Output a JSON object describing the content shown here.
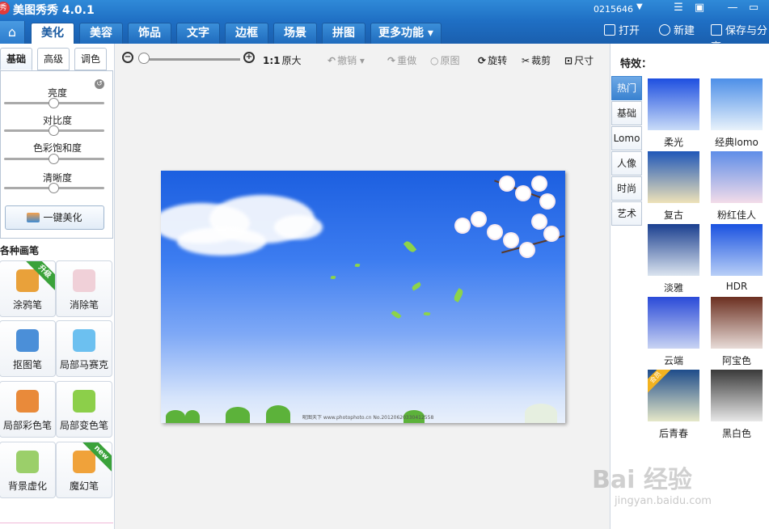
{
  "app": {
    "logo_text": "秀",
    "title": "美图秀秀 4.0.1",
    "user_id": "0215646",
    "window_controls": [
      "menu-icon",
      "minimize-icon",
      "maximize-icon",
      "close-icon"
    ]
  },
  "nav": {
    "home_icon": "home-icon",
    "tabs": [
      {
        "label": "美化",
        "active": true
      },
      {
        "label": "美容",
        "active": false
      },
      {
        "label": "饰品",
        "active": false
      },
      {
        "label": "文字",
        "active": false
      },
      {
        "label": "边框",
        "active": false
      },
      {
        "label": "场景",
        "active": false
      },
      {
        "label": "拼图",
        "active": false
      },
      {
        "label": "更多功能 ▾",
        "active": false
      }
    ],
    "right": [
      {
        "label": "打开",
        "icon": "folder-icon"
      },
      {
        "label": "新建",
        "icon": "plus-icon"
      },
      {
        "label": "保存与分享",
        "icon": "save-icon"
      }
    ]
  },
  "left": {
    "tabs": [
      {
        "label": "基础",
        "active": true
      },
      {
        "label": "高级",
        "active": false
      },
      {
        "label": "调色",
        "active": false
      }
    ],
    "sliders": [
      {
        "label": "亮度",
        "value": 0.5
      },
      {
        "label": "对比度",
        "value": 0.5
      },
      {
        "label": "色彩饱和度",
        "value": 0.5
      },
      {
        "label": "清晰度",
        "value": 0.5
      }
    ],
    "one_click": "一键美化",
    "brush_section": "各种画笔",
    "brushes": [
      {
        "label": "涂鸦笔",
        "icon": "graffiti-brush-icon",
        "badge": "升级",
        "color": "#e9a13a"
      },
      {
        "label": "消除笔",
        "icon": "eraser-icon",
        "badge": "",
        "color": "#f0d0d8"
      },
      {
        "label": "抠图笔",
        "icon": "cutout-pen-icon",
        "badge": "",
        "color": "#4b8fd8"
      },
      {
        "label": "局部马赛克",
        "icon": "mosaic-icon",
        "badge": "",
        "color": "#6cc0f0"
      },
      {
        "label": "局部彩色笔",
        "icon": "color-brush-icon",
        "badge": "",
        "color": "#e98a3a"
      },
      {
        "label": "局部变色笔",
        "icon": "recolor-bucket-icon",
        "badge": "",
        "color": "#8ccf4a"
      },
      {
        "label": "背景虚化",
        "icon": "blur-background-icon",
        "badge": "",
        "color": "#9bcf6a"
      },
      {
        "label": "魔幻笔",
        "icon": "magic-wand-icon",
        "badge": "new",
        "color": "#f0a23a"
      }
    ]
  },
  "toolbar": {
    "zoom": {
      "value": 0.0
    },
    "original_size_prefix": "1:1",
    "original_size": "原大",
    "undo": "撤销",
    "redo": "重做",
    "original": "原图",
    "rotate": "旋转",
    "crop": "裁剪",
    "resize": "尺寸"
  },
  "canvas": {
    "watermark": "昵图天下 www.photophoto.cn  No.20120620330412558"
  },
  "right": {
    "title": "特效：",
    "tabs": [
      {
        "label": "热门",
        "active": true
      },
      {
        "label": "基础",
        "active": false
      },
      {
        "label": "Lomo",
        "active": false
      },
      {
        "label": "人像",
        "active": false
      },
      {
        "label": "时尚",
        "active": false
      },
      {
        "label": "艺术",
        "active": false
      }
    ],
    "effects": [
      {
        "label": "柔光",
        "top": "#1e4fe0",
        "bottom": "#c9dcf8",
        "vip": false
      },
      {
        "label": "经典lomo",
        "top": "#4d8fe8",
        "bottom": "#e8f2fb",
        "vip": false
      },
      {
        "label": "复古",
        "top": "#1f57b8",
        "bottom": "#eee2b8",
        "vip": false
      },
      {
        "label": "粉红佳人",
        "top": "#5e8de8",
        "bottom": "#f3dce9",
        "vip": false
      },
      {
        "label": "淡雅",
        "top": "#1a3f8f",
        "bottom": "#dbe4ef",
        "vip": false
      },
      {
        "label": "HDR",
        "top": "#1a52e0",
        "bottom": "#b8cff7",
        "vip": false
      },
      {
        "label": "云端",
        "top": "#2a4ad8",
        "bottom": "#c9d4f3",
        "vip": false
      },
      {
        "label": "阿宝色",
        "top": "#6b2f20",
        "bottom": "#e8dcd8",
        "vip": false
      },
      {
        "label": "后青春",
        "top": "#1e4c8a",
        "bottom": "#e6e8c8",
        "vip": true,
        "vip_label": "会员"
      },
      {
        "label": "黑白色",
        "top": "#3a3a3a",
        "bottom": "#e8e8e8",
        "vip": false
      }
    ]
  },
  "watermark_site": {
    "brand": "Bai 经验",
    "url": "jingyan.baidu.com"
  }
}
